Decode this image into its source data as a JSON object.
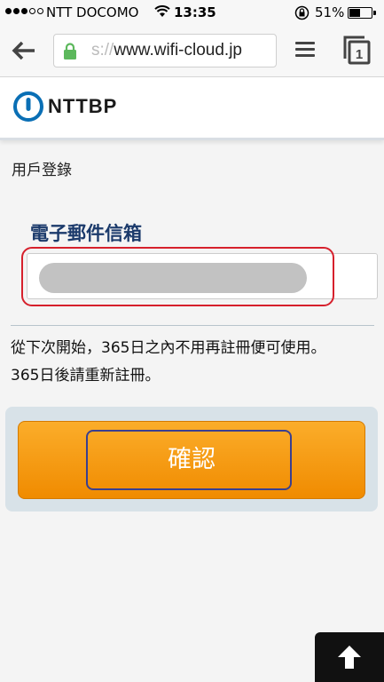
{
  "status_bar": {
    "carrier": "NTT DOCOMO",
    "time": "13:35",
    "battery": "51%"
  },
  "browser": {
    "url_prefix": "s://",
    "url_host": "www.wifi-cloud.jp"
  },
  "site": {
    "logo": "NTTBP",
    "brand_color": "#0a6fb5"
  },
  "page": {
    "heading": "用戶登錄",
    "email_label": "電子郵件信箱",
    "email_value": "",
    "notice_line1": "從下次開始，365日之內不用再註冊便可使用。",
    "notice_line2": "365日後請重新註冊。",
    "confirm_label": "確認",
    "accent": "#f59400"
  },
  "icons": {
    "back": "back-arrow-icon",
    "lock": "lock-icon",
    "menu": "menu-icon",
    "tabs": "tabs-icon",
    "scroll_top": "up-arrow-icon"
  }
}
